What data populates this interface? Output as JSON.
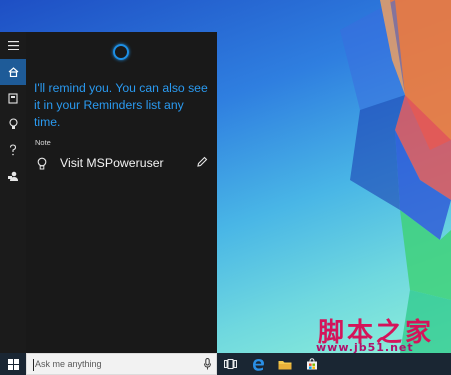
{
  "cortana": {
    "message": "I'll remind you. You can also see it in your Reminders list any time.",
    "note_label": "Note",
    "reminder_text": "Visit MSPoweruser"
  },
  "sidebar": {
    "items": [
      {
        "icon": "hamburger-menu-icon"
      },
      {
        "icon": "home-icon",
        "active": true
      },
      {
        "icon": "notebook-icon"
      },
      {
        "icon": "lightbulb-icon"
      },
      {
        "icon": "help-icon"
      },
      {
        "icon": "feedback-icon"
      }
    ]
  },
  "taskbar": {
    "search_placeholder": "Ask me anything",
    "icons": [
      "windows-start-icon",
      "microphone-icon",
      "task-view-icon",
      "edge-browser-icon",
      "file-explorer-icon",
      "store-icon"
    ]
  },
  "watermark": {
    "text": "脚本之家",
    "url": "www.jb51.net"
  },
  "colors": {
    "accent": "#1e8fe6",
    "panel_bg": "#191919",
    "rail_bg": "#1b1b1b",
    "active_item": "#1e5b98",
    "taskbar_bg": "#1a2633",
    "watermark": "#d4145a"
  }
}
